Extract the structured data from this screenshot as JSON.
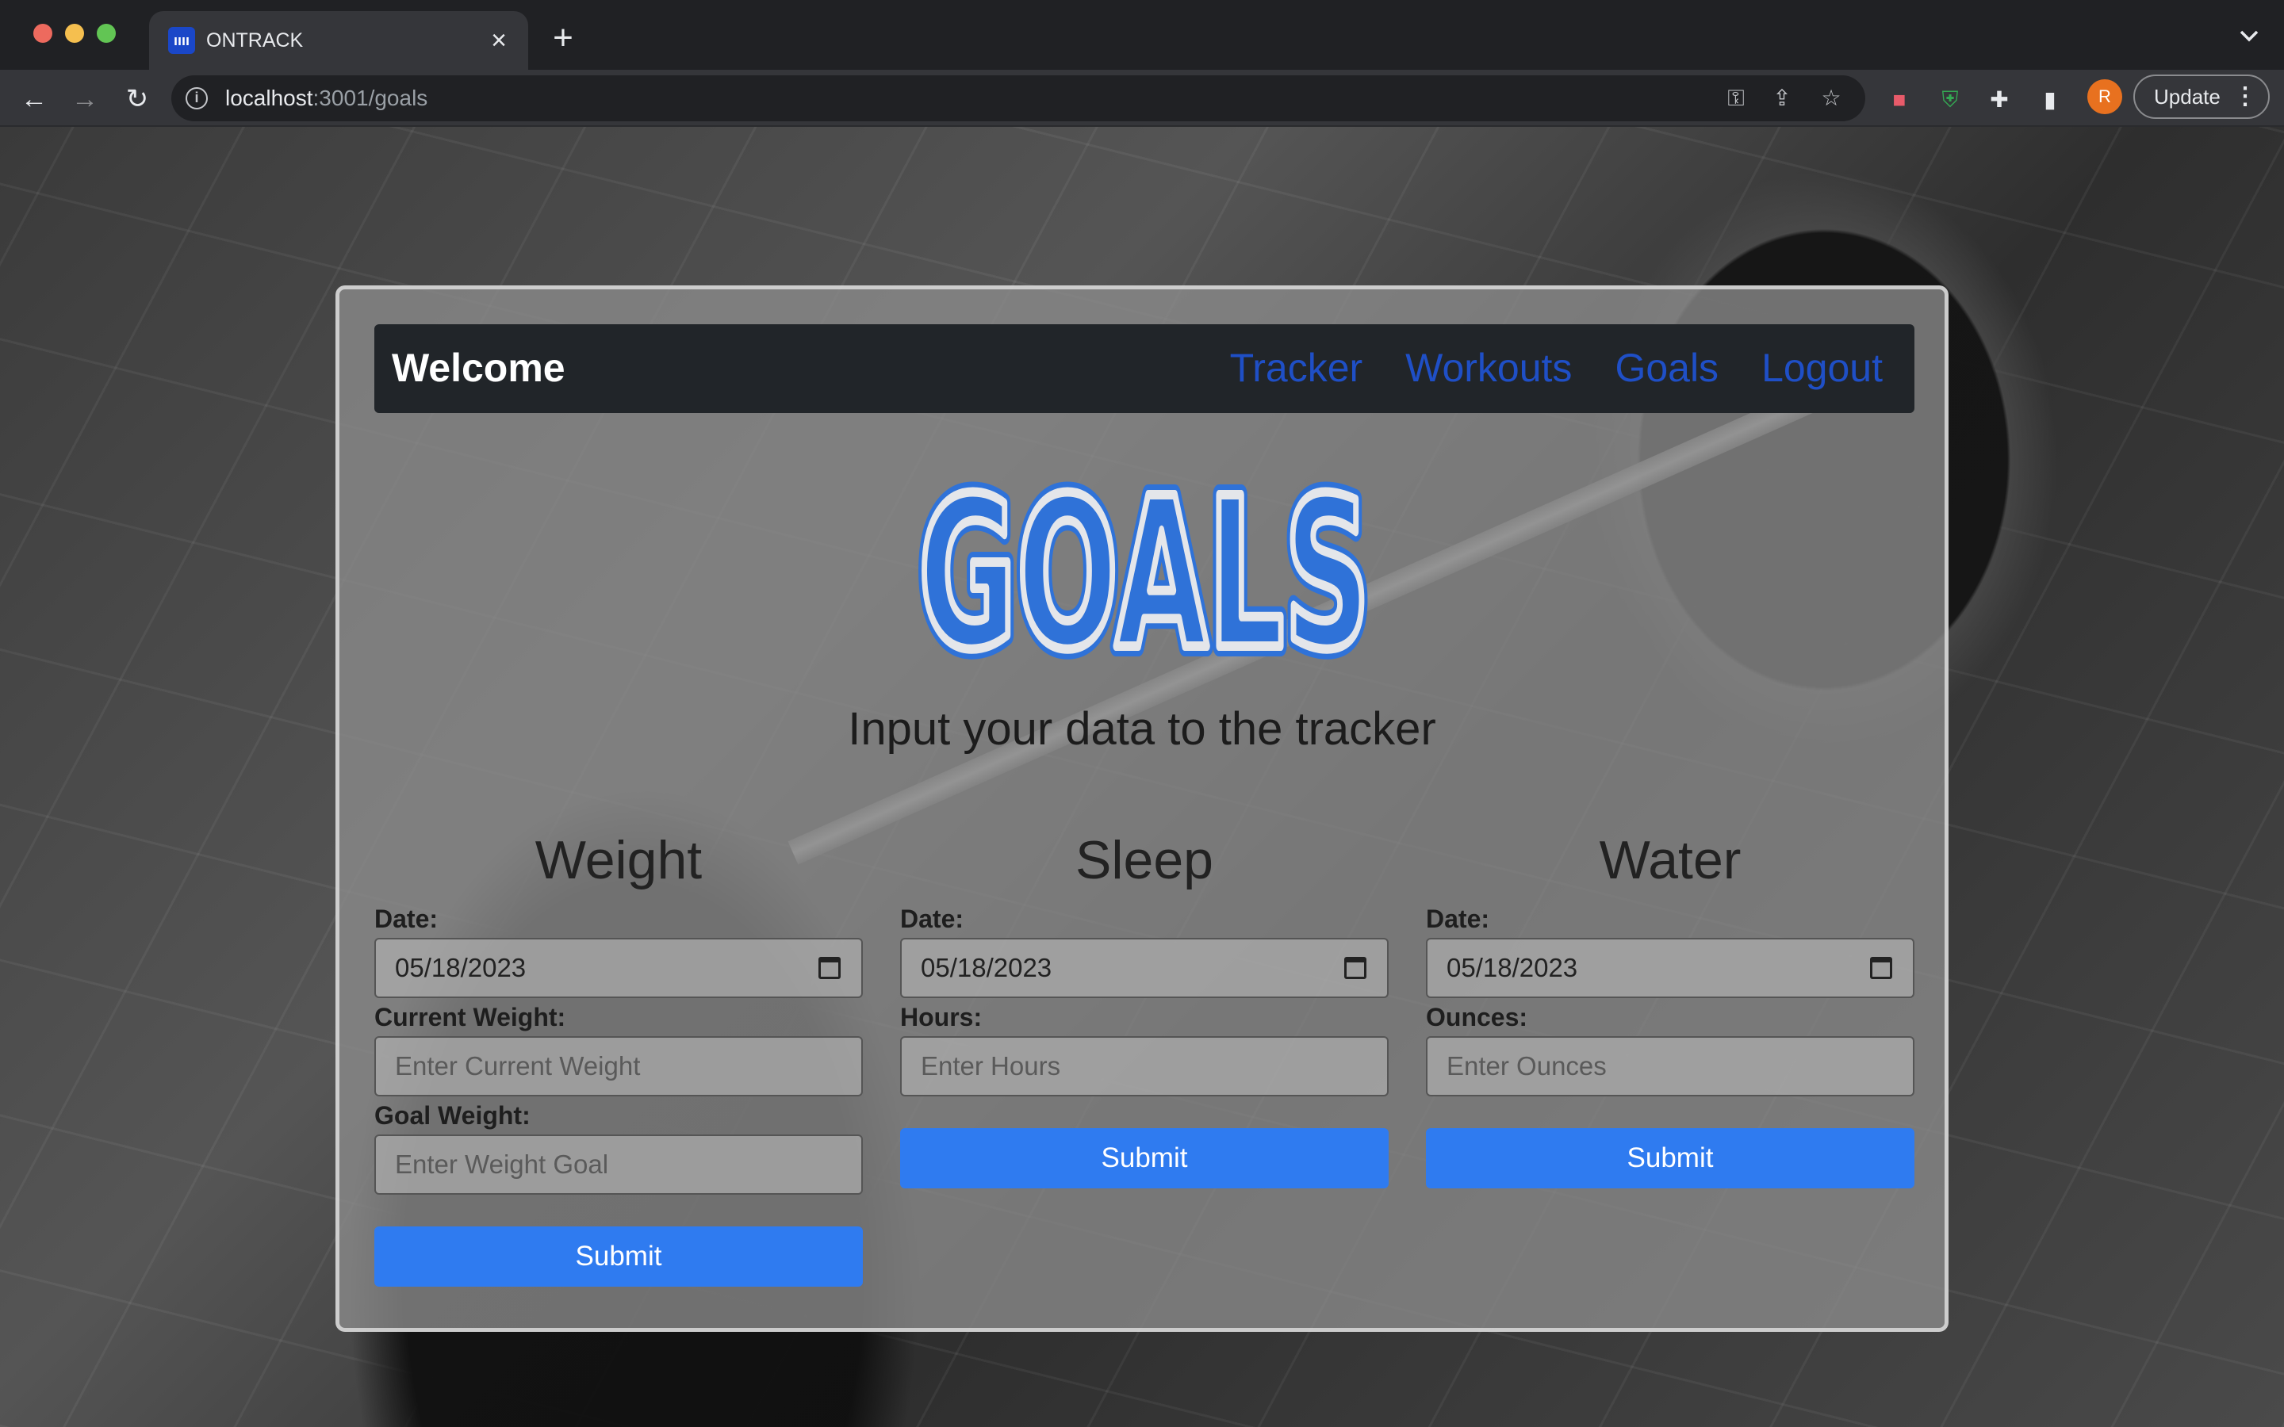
{
  "browser": {
    "tab_title": "ONTRACK",
    "favicon_label": "ıııı",
    "url_host": "localhost",
    "url_path": ":3001/goals",
    "update_label": "Update",
    "profile_initial": "R",
    "icons": {
      "back": "back-arrow-icon",
      "forward": "forward-arrow-icon",
      "reload": "reload-icon",
      "key": "key-icon",
      "share": "share-icon",
      "star": "star-icon",
      "extensions": "puzzle-icon",
      "sidebar": "sidebar-icon"
    }
  },
  "navbar": {
    "brand": "Welcome",
    "links": [
      "Tracker",
      "Workouts",
      "Goals",
      "Logout"
    ],
    "link_color": "#1f4fc6"
  },
  "hero": {
    "title": "GOALS",
    "subtitle": "Input your data to the tracker"
  },
  "sections": {
    "weight": {
      "title": "Weight",
      "date_label": "Date:",
      "date_value": "05/18/2023",
      "current_label": "Current Weight:",
      "current_placeholder": "Enter Current Weight",
      "goal_label": "Goal Weight:",
      "goal_placeholder": "Enter Weight Goal",
      "submit": "Submit"
    },
    "sleep": {
      "title": "Sleep",
      "date_label": "Date:",
      "date_value": "05/18/2023",
      "hours_label": "Hours:",
      "hours_placeholder": "Enter Hours",
      "submit": "Submit"
    },
    "water": {
      "title": "Water",
      "date_label": "Date:",
      "date_value": "05/18/2023",
      "ounces_label": "Ounces:",
      "ounces_placeholder": "Enter Ounces",
      "submit": "Submit"
    }
  },
  "colors": {
    "accent": "#2f7bf0",
    "navbar_bg": "#212529",
    "logo_blue": "#2f72d8"
  }
}
